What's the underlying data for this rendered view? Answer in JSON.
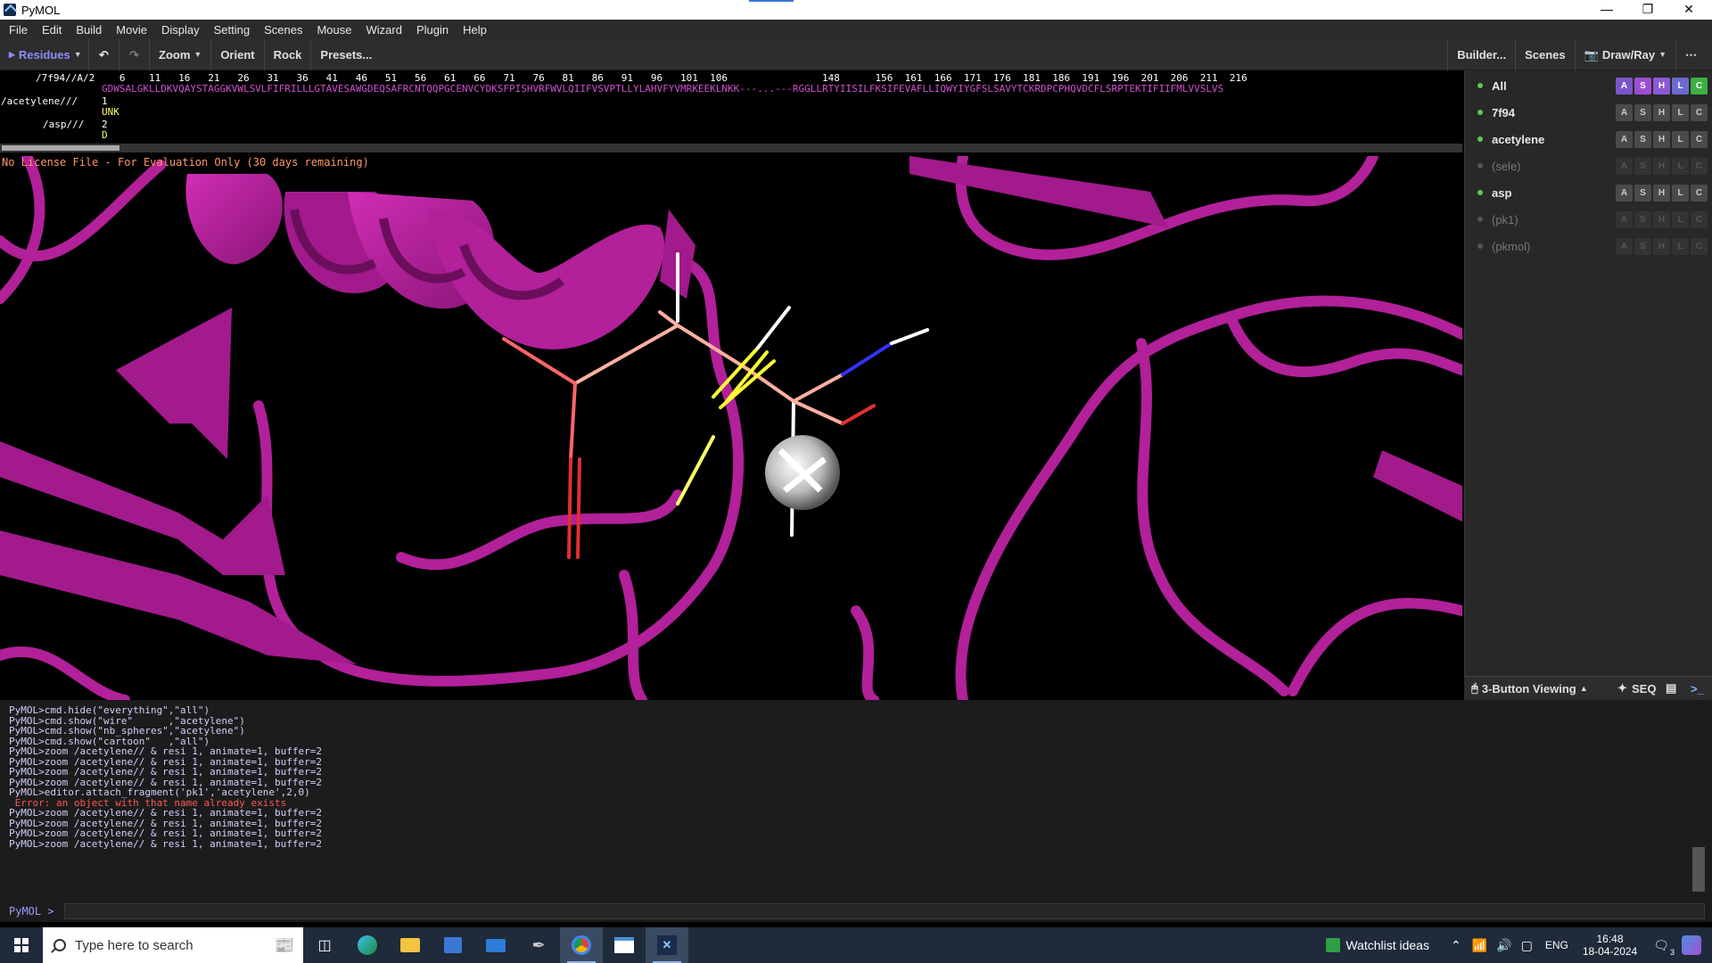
{
  "window": {
    "title": "PyMOL"
  },
  "menu": [
    "File",
    "Edit",
    "Build",
    "Movie",
    "Display",
    "Setting",
    "Scenes",
    "Mouse",
    "Wizard",
    "Plugin",
    "Help"
  ],
  "toolbar": {
    "residues": "Residues",
    "zoom": "Zoom",
    "orient": "Orient",
    "rock": "Rock",
    "presets": "Presets...",
    "builder": "Builder...",
    "scenes": "Scenes",
    "drawray": "Draw/Ray"
  },
  "sequence": {
    "label_7f94": "/7f94//A/2",
    "numbers": "   6    11   16   21   26   31   36   41   46   51   56   61   66   71   76   81   86   91   96   101  106                148      156  161  166  171  176  181  186  191  196  201  206  211  216",
    "aa_7f94": "GDWSALGKLLDKVQAYSTAGGKVWLSVLFIFRILLLGTAVESAWGDEQSAFRCNTQQPGCENVCYDKSFPISHVRFWVLQIIFVSVPTLLYLAHVFYVMRKEEKLNKK---...---RGGLLRTYIISILFKSIFEVAFLLIQWYIYGFSLSAVYTCKRDPCPHQVDCFLSRPTEKTIFIIFMLVVSLVS",
    "label_acetylene": "/acetylene///",
    "num_acetylene": "1",
    "res_acetylene": "UNK",
    "label_asp": "/asp///",
    "num_asp": "2",
    "res_asp": "D"
  },
  "viewport": {
    "license": "No License File - For Evaluation Only (30 days remaining)"
  },
  "objects": [
    {
      "name": "All",
      "enabled": true
    },
    {
      "name": "7f94",
      "enabled": true
    },
    {
      "name": "acetylene",
      "enabled": true
    },
    {
      "name": "(sele)",
      "enabled": false
    },
    {
      "name": "asp",
      "enabled": true
    },
    {
      "name": "(pk1)",
      "enabled": false
    },
    {
      "name": "(pkmol)",
      "enabled": false
    }
  ],
  "object_buttons": [
    "A",
    "S",
    "H",
    "L",
    "C"
  ],
  "panel_bottom": {
    "viewing": "3-Button Viewing",
    "seq": "SEQ"
  },
  "console": [
    {
      "text": "PyMOL>cmd.hide(\"everything\",\"all\")",
      "err": false
    },
    {
      "text": "PyMOL>cmd.show(\"wire\"      ,\"acetylene\")",
      "err": false
    },
    {
      "text": "PyMOL>cmd.show(\"nb_spheres\",\"acetylene\")",
      "err": false
    },
    {
      "text": "PyMOL>cmd.show(\"cartoon\"   ,\"all\")",
      "err": false
    },
    {
      "text": "PyMOL>zoom /acetylene// & resi 1, animate=1, buffer=2",
      "err": false
    },
    {
      "text": "PyMOL>zoom /acetylene// & resi 1, animate=1, buffer=2",
      "err": false
    },
    {
      "text": "PyMOL>zoom /acetylene// & resi 1, animate=1, buffer=2",
      "err": false
    },
    {
      "text": "PyMOL>zoom /acetylene// & resi 1, animate=1, buffer=2",
      "err": false
    },
    {
      "text": "PyMOL>editor.attach_fragment('pk1','acetylene',2,0)",
      "err": false
    },
    {
      "text": " Error: an object with that name already exists",
      "err": true
    },
    {
      "text": "PyMOL>zoom /acetylene// & resi 1, animate=1, buffer=2",
      "err": false
    },
    {
      "text": "PyMOL>zoom /acetylene// & resi 1, animate=1, buffer=2",
      "err": false
    },
    {
      "text": "PyMOL>zoom /acetylene// & resi 1, animate=1, buffer=2",
      "err": false
    },
    {
      "text": "PyMOL>zoom /acetylene// & resi 1, animate=1, buffer=2",
      "err": false
    }
  ],
  "prompt": "PyMOL >",
  "taskbar": {
    "search_placeholder": "Type here to search",
    "watchlist": "Watchlist ideas",
    "lang": "ENG",
    "time": "16:48",
    "date": "18-04-2024",
    "notif_count": "3"
  },
  "colors": {
    "cartoon": "#b2209a",
    "accent": "#8c8cff"
  }
}
